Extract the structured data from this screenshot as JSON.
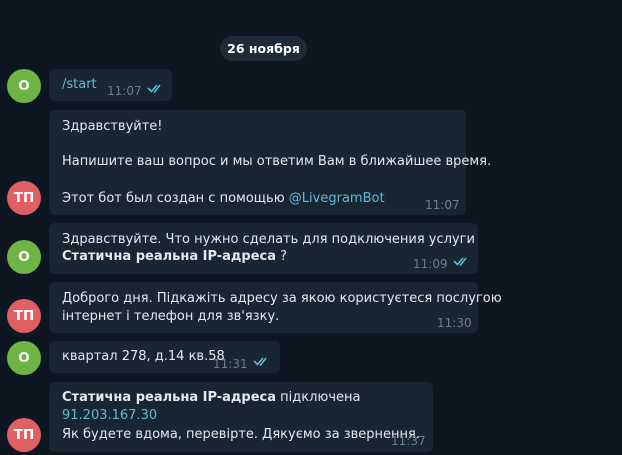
{
  "date_separator": "26 ноября",
  "messages": [
    {
      "avatar": "О",
      "command": "/start",
      "time": "11:07"
    },
    {
      "avatar": "ТП",
      "greeting": "Здравствуйте!",
      "prompt": "Напишите ваш вопрос и мы ответим Вам в ближайшее время.",
      "footer_prefix": "Этот бот был создан с помощью ",
      "footer_link": "@LivegramBot",
      "time": "11:07"
    },
    {
      "avatar": "О",
      "line1": "Здравствуйте.  Что нужно сделать для подключения услуги",
      "service_bold": "Статична реальна IP-адреса",
      "service_suffix": " ?",
      "time": "11:09"
    },
    {
      "avatar": "ТП",
      "line1": "Доброго дня. Підкажіть адресу за якою користуєтеся послугою",
      "line2": "інтернет і телефон для зв'язку.",
      "time": "11:30"
    },
    {
      "avatar": "О",
      "text": "квартал 278, д.14  кв.58",
      "time": "11:31"
    },
    {
      "avatar": "ТП",
      "service_bold": "Статична реальна IP-адреса",
      "service_suffix": " підключена",
      "ip": "91.203.167.30",
      "line3": "Як будете вдома, перевірте. Дякуємо за звернення.",
      "time": "11:37"
    }
  ],
  "colors": {
    "background": "#0e1621",
    "bubble": "#182533",
    "date_pill": "#1e2c3a",
    "avatar_user": "#6fb545",
    "avatar_support": "#df5f62",
    "link": "#5fbcd3",
    "read_check": "#5fbcd3",
    "time": "#6d7f8f"
  },
  "icons": [
    "double-check-icon"
  ]
}
